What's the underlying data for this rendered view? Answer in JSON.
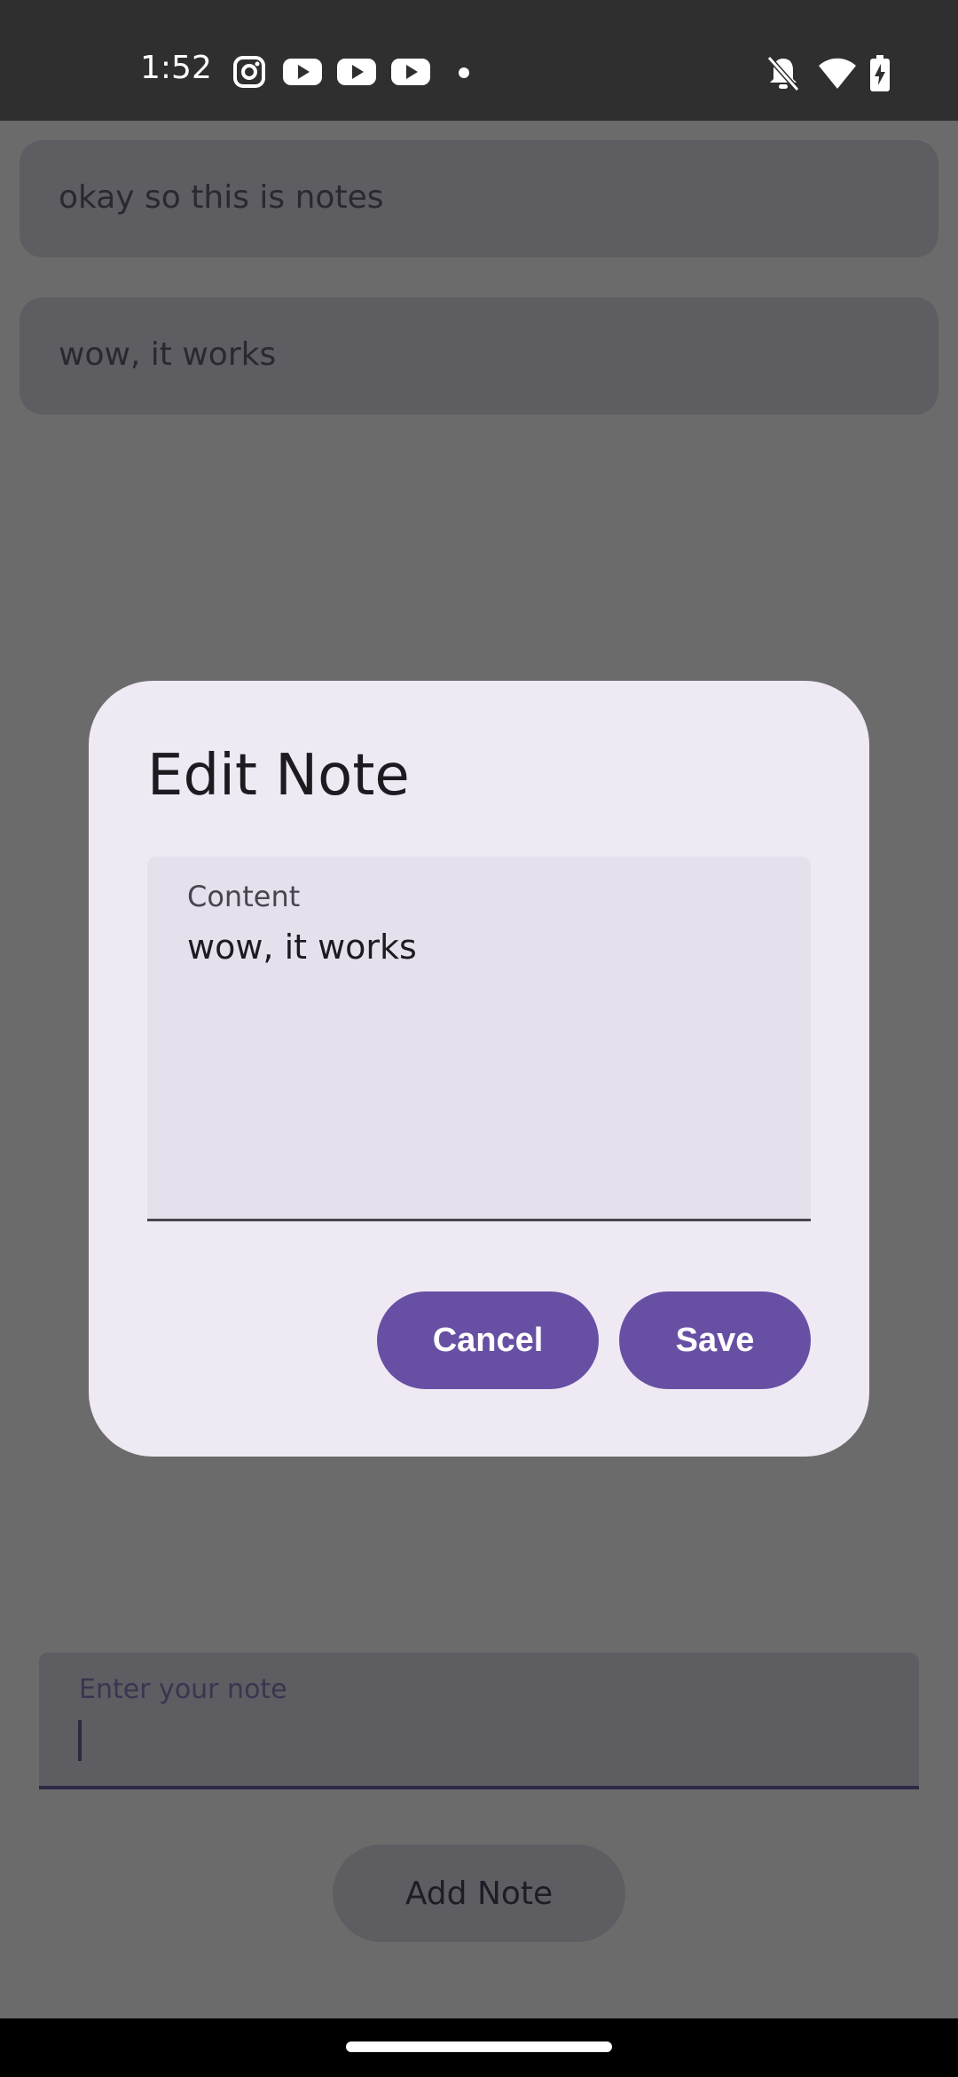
{
  "status_bar": {
    "time": "1:52",
    "notification_icons": [
      "instagram-icon",
      "youtube-icon",
      "youtube-icon",
      "youtube-icon",
      "dot-icon"
    ],
    "system_icons": [
      "bell-off-icon",
      "wifi-icon",
      "battery-charging-icon"
    ]
  },
  "notes": [
    {
      "text": "okay so this is notes"
    },
    {
      "text": "wow, it works"
    }
  ],
  "dialog": {
    "title": "Edit Note",
    "field_label": "Content",
    "field_value": "wow, it works",
    "cancel_label": "Cancel",
    "save_label": "Save"
  },
  "composer": {
    "placeholder": "Enter your note",
    "add_label": "Add Note"
  },
  "colors": {
    "primary": "#6750a4",
    "dialog_bg": "#efe9f4",
    "scrim": "#6b6b6b"
  }
}
